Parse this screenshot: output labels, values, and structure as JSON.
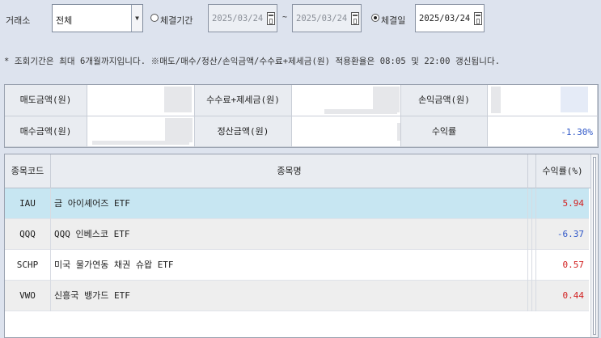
{
  "filters": {
    "market_label": "거래소",
    "market_value": "전체",
    "range_label": "체결기간",
    "range_start": "2025/03/24",
    "range_sep": "~",
    "range_end": "2025/03/24",
    "day_label": "체결일",
    "day_value": "2025/03/24"
  },
  "notice": "* 조회기간은 최대 6개월까지입니다. ※매도/매수/정산/손익금액/수수료+제세금(원) 적용환율은 08:05 및 22:00 갱신됩니다.",
  "summary": {
    "sell_amount_label": "매도금액(원)",
    "fee_tax_label": "수수료+제세금(원)",
    "pnl_label": "손익금액(원)",
    "buy_amount_label": "매수금액(원)",
    "settle_label": "정산금액(원)",
    "return_label": "수익률",
    "return_value": "-1.30%"
  },
  "table": {
    "columns": [
      "종목코드",
      "종목명",
      "수익률(%)"
    ],
    "rows": [
      {
        "code": "IAU",
        "name": "금 아이셰어즈 ETF",
        "yield": "5.94"
      },
      {
        "code": "QQQ",
        "name": "QQQ 인베스코 ETF",
        "yield": "-6.37"
      },
      {
        "code": "SCHP",
        "name": "미국 물가연동 채권 슈왑 ETF",
        "yield": "0.57"
      },
      {
        "code": "VWO",
        "name": "신흥국 뱅가드 ETF",
        "yield": "0.44"
      }
    ]
  },
  "colors": {
    "positive": "#d22020",
    "negative": "#2f57c8",
    "selected_row": "#c7e6f2"
  },
  "icons": {
    "dropdown": "triangle-down-icon",
    "calendar": "calendar-icon"
  }
}
